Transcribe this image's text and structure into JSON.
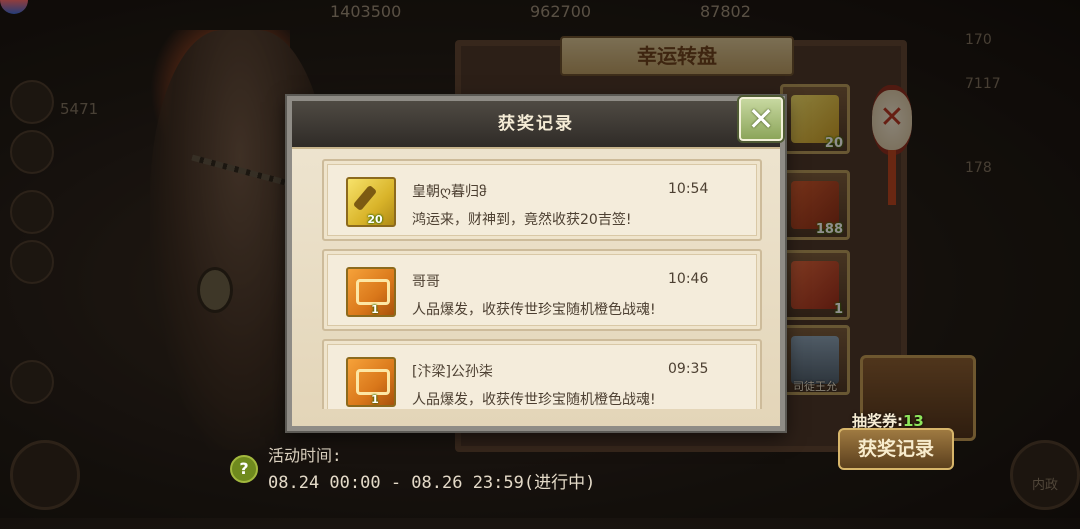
{
  "background": {
    "top_stats": [
      {
        "label": "",
        "value": "1403500"
      },
      {
        "label": "",
        "value": "962700"
      },
      {
        "label": "",
        "value": "87802"
      }
    ],
    "left_tag": "5471",
    "right_list": [
      "170",
      "7117",
      "178"
    ],
    "wheel_title": "幸运转盘",
    "tiles": [
      {
        "icon": "scroll-icon",
        "count": "20",
        "caption": ""
      },
      {
        "icon": "shield-icon",
        "count": "188",
        "caption": ""
      },
      {
        "icon": "banner-icon",
        "count": "1",
        "caption": ""
      },
      {
        "icon": "hero-portrait-icon",
        "count": "",
        "caption": "司徒王允"
      }
    ],
    "lantern_glyph": "✕",
    "ticket_label": "抽奖券:",
    "ticket_count": "13",
    "record_button": "获奖记录",
    "event_label": "活动时间:",
    "event_time": "08.24 00:00 - 08.26 23:59(进行中)",
    "corner_left": "",
    "corner_right": "内政"
  },
  "modal": {
    "title": "获奖记录",
    "close_glyph": "✕",
    "records": [
      {
        "name": "皇朝ღ暮归ჵ",
        "time": "10:54",
        "message": "鸿运来，财神到，竟然收获20吉签!",
        "icon": "scroll-icon",
        "count": "20"
      },
      {
        "name": "哥哥",
        "time": "10:46",
        "message": "人品爆发，收获传世珍宝随机橙色战魂!",
        "icon": "chest-icon",
        "count": "1"
      },
      {
        "name": "[汴梁]公孙柒",
        "time": "09:35",
        "message": "人品爆发，收获传世珍宝随机橙色战魂!",
        "icon": "chest-icon",
        "count": "1"
      }
    ]
  }
}
